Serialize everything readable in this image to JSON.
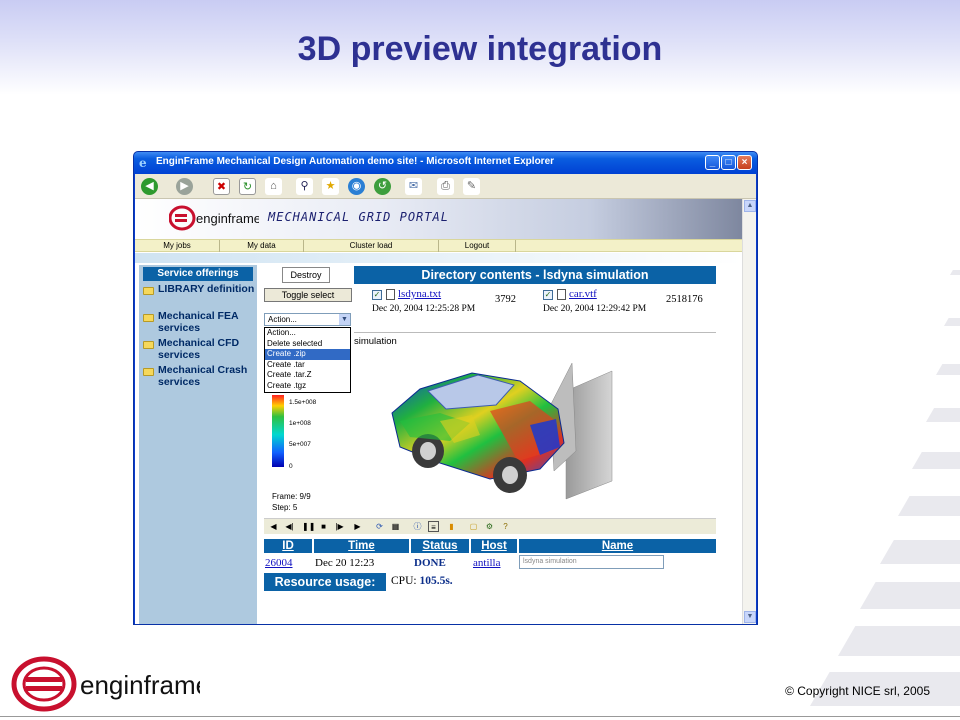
{
  "slide": {
    "title": "3D preview integration",
    "copyright": "© Copyright NICE srl, 2005",
    "logo_text": "enginframe"
  },
  "browser": {
    "window_title": "EnginFrame Mechanical Design Automation demo site! - Microsoft Internet Explorer",
    "controls": {
      "minimize": "_",
      "maximize": "□",
      "close": "×"
    },
    "toolbar_icons": [
      "back-icon",
      "forward-icon",
      "stop-icon",
      "refresh-icon",
      "home-icon",
      "search-icon",
      "favorites-icon",
      "media-icon",
      "history-icon",
      "mail-icon",
      "print-icon",
      "edit-icon"
    ]
  },
  "portal": {
    "brand": "enginframe",
    "portal_name": "MECHANICAL GRID PORTAL",
    "nav": [
      "My jobs",
      "My data",
      "Cluster load",
      "Logout"
    ]
  },
  "sidebar": {
    "heading": "Service offerings",
    "items": [
      {
        "label": "LIBRARY definition"
      },
      {
        "label": "Mechanical FEA services"
      },
      {
        "label": "Mechanical CFD services"
      },
      {
        "label": "Mechanical Crash services"
      }
    ]
  },
  "directory": {
    "destroy_label": "Destroy",
    "toggle_label": "Toggle select",
    "header": "Directory contents - lsdyna simulation",
    "files": [
      {
        "name": "lsdyna.txt",
        "date": "Dec 20, 2004 12:25:28 PM",
        "size": "3792"
      },
      {
        "name": "car.vtf",
        "date": "Dec 20, 2004 12:29:42 PM",
        "size": "2518176"
      }
    ],
    "action_select": "Action...",
    "action_options": [
      "Action...",
      "Delete selected",
      "Create .zip",
      "Create .tar",
      "Create .tar.Z",
      "Create .tgz"
    ],
    "selected_action": "Create .zip"
  },
  "preview": {
    "label": "simulation",
    "legend_values": [
      "1.5e+008",
      "1e+008",
      "5e+007",
      "0"
    ],
    "frame": "Frame: 9/9",
    "step": "Step: 5",
    "player_controls": [
      "rewind-icon",
      "step-back-icon",
      "pause-icon",
      "stop-icon",
      "step-forward-icon",
      "play-icon",
      "rotate-icon",
      "grid-icon",
      "info-icon",
      "legend-icon",
      "color-scale-icon",
      "open-folder-icon",
      "settings-icon",
      "help-icon"
    ]
  },
  "jobs": {
    "columns": [
      "ID",
      "Time",
      "Status",
      "Host",
      "Name"
    ],
    "row": {
      "id": "26004",
      "time": "Dec 20 12:23",
      "status": "DONE",
      "host": "antilla",
      "name": "lsdyna simulation"
    }
  },
  "resource": {
    "label": "Resource usage:",
    "cpu_label": "CPU:",
    "cpu_value": "105.5s."
  },
  "colors": {
    "title": "#2e3192",
    "header_blue": "#0b62a6",
    "sidebar": "#aec9df",
    "xp_titlebar": "#0041d3"
  }
}
